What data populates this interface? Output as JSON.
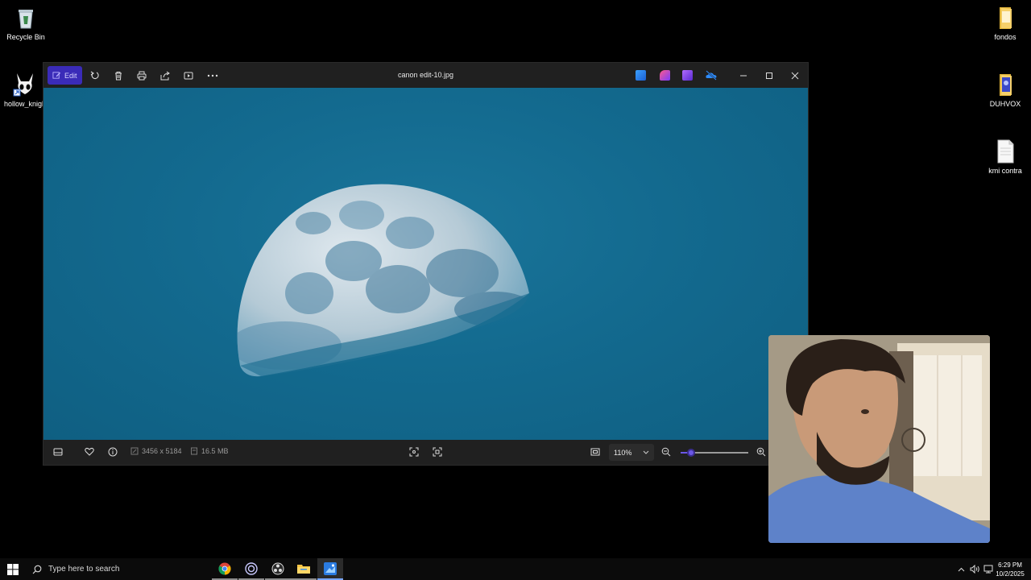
{
  "desktop": {
    "icons_left": [
      {
        "label": "Recycle Bin",
        "icon": "recycle-bin-icon"
      },
      {
        "label": "hollow_knigh",
        "icon": "hollow-knight-icon"
      }
    ],
    "icons_right": [
      {
        "label": "fondos",
        "icon": "folder-icon"
      },
      {
        "label": "DUHVOX",
        "icon": "folder-icon"
      },
      {
        "label": "kmi contra",
        "icon": "document-icon"
      }
    ]
  },
  "photos_window": {
    "title": "canon edit-10.jpg",
    "edit_label": "Edit",
    "toolbar_icons": [
      "rotate-icon",
      "delete-icon",
      "print-icon",
      "share-icon",
      "slideshow-icon",
      "more-icon"
    ],
    "app_icons": [
      "photos-app-icon",
      "clipchamp-icon",
      "video-editor-icon",
      "onedrive-icon"
    ],
    "status": {
      "dimensions": "3456 x 5184",
      "file_size": "16.5 MB",
      "zoom": "110%",
      "zoom_level_fraction": 0.15
    }
  },
  "taskbar": {
    "search_placeholder": "Type here to search",
    "apps": [
      "chrome-icon",
      "steelseries-icon",
      "obs-icon",
      "file-explorer-icon",
      "photos-icon"
    ],
    "time": "6:29 PM",
    "date": "10/2/2025"
  },
  "colors": {
    "accent": "#3a2bb8",
    "slider": "#6b57e6",
    "sky": "#136a8f"
  }
}
